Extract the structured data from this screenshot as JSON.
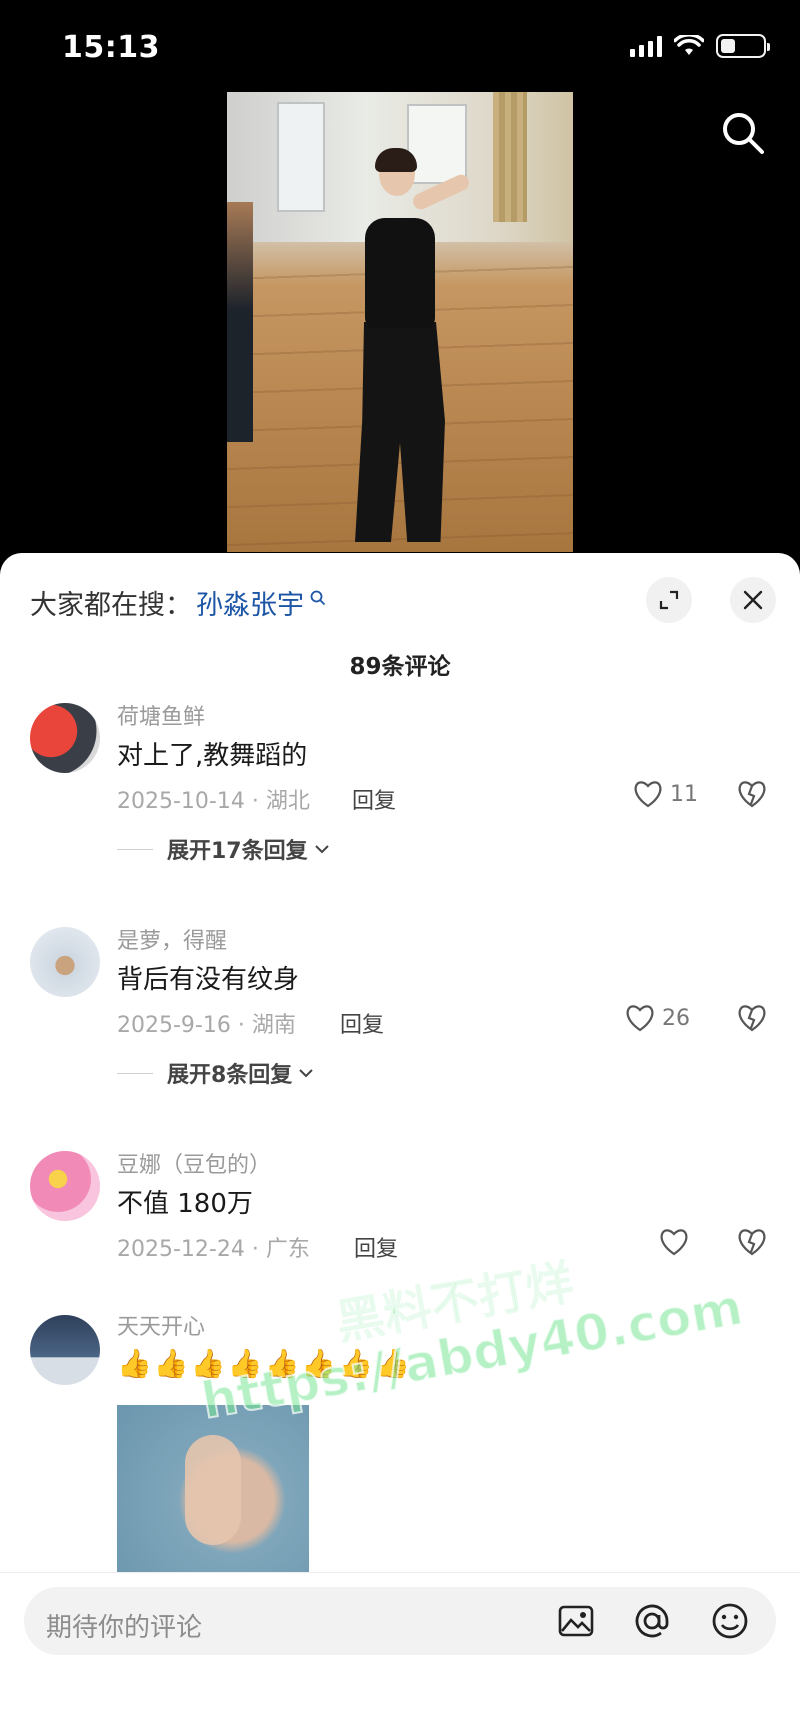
{
  "status_bar": {
    "time": "15:13",
    "battery_level": 0.35
  },
  "search_banner": {
    "prefix": "大家都在搜：",
    "term": "孙淼张宇"
  },
  "comment_count": "89条评论",
  "comments": [
    {
      "user": "荷塘鱼鲜",
      "text": "对上了,教舞蹈的",
      "date_loc": "2025-10-14 · 湖北",
      "reply": "回复",
      "likes": "11",
      "expand": "展开17条回复"
    },
    {
      "user": "是萝，得醒",
      "text": "背后有没有纹身",
      "date_loc": "2025-9-16 · 湖南",
      "reply": "回复",
      "likes": "26",
      "expand": "展开8条回复"
    },
    {
      "user": "豆娜（豆包的）",
      "text": "不值 180万",
      "date_loc": "2025-12-24 · 广东",
      "reply": "回复",
      "likes": ""
    },
    {
      "user": "天天开心",
      "emoji": "👍👍👍👍👍👍👍👍"
    }
  ],
  "watermark": {
    "line1": "黑料不打烊",
    "line2": "https://abdy40.com"
  },
  "input": {
    "placeholder": "期待你的评论"
  },
  "colors": {
    "accent": "#1c56a5",
    "watermark": "#78e696"
  }
}
